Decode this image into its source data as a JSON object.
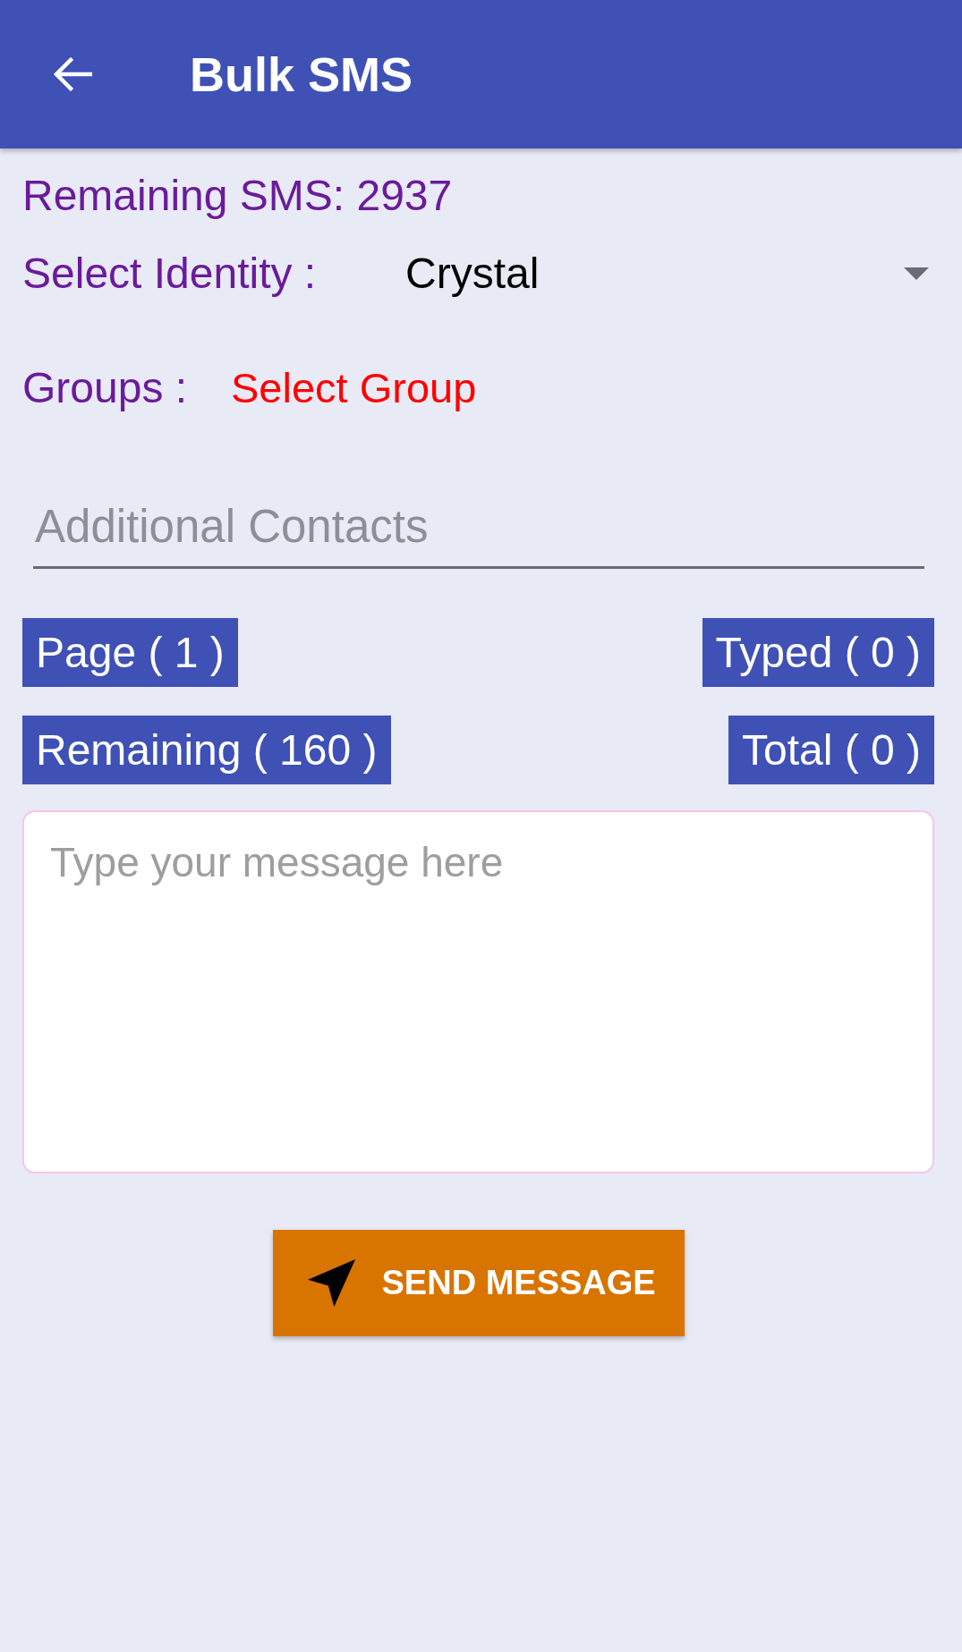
{
  "app_bar": {
    "title": "Bulk SMS"
  },
  "remaining_sms": "Remaining SMS: 2937",
  "identity": {
    "label": "Select Identity :",
    "value": "Crystal"
  },
  "groups": {
    "label": "Groups :",
    "value": "Select Group"
  },
  "additional_contacts": {
    "placeholder": "Additional Contacts"
  },
  "counter_rows": [
    {
      "left": "Page ( 1 )",
      "right": "Typed ( 0 )"
    },
    {
      "left": "Remaining ( 160 )",
      "right": "Total ( 0 )"
    }
  ],
  "message": {
    "placeholder": "Type your message here"
  },
  "send_button": {
    "label": "SEND MESSAGE"
  }
}
